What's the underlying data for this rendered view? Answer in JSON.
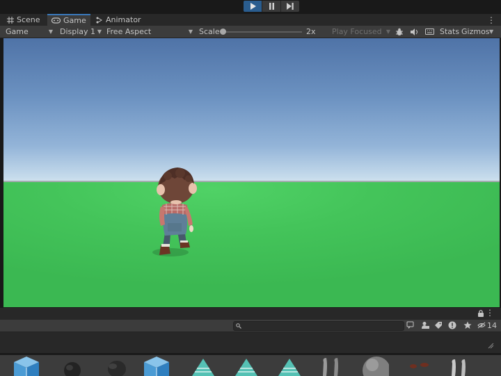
{
  "window": {
    "tabs": [
      {
        "label": "Scene",
        "icon": "grid-icon"
      },
      {
        "label": "Game",
        "icon": "gamepad-icon"
      },
      {
        "label": "Animator",
        "icon": "animator-icon"
      }
    ],
    "active_tab": "Game"
  },
  "game_toolbar": {
    "view_dropdown": "Game",
    "display_dropdown": "Display 1",
    "aspect_dropdown": "Free Aspect",
    "scale_label": "Scale",
    "scale_value": "2x",
    "play_focused": "Play Focused",
    "stats_label": "Stats",
    "gizmos_label": "Gizmos"
  },
  "console": {
    "hidden_count": "14"
  },
  "colors": {
    "accent": "#3a79bb",
    "play_active": "#2a5d8f",
    "panel": "#3c3c3c",
    "ground": "#44c45a",
    "sky_top": "#4f73a7"
  }
}
